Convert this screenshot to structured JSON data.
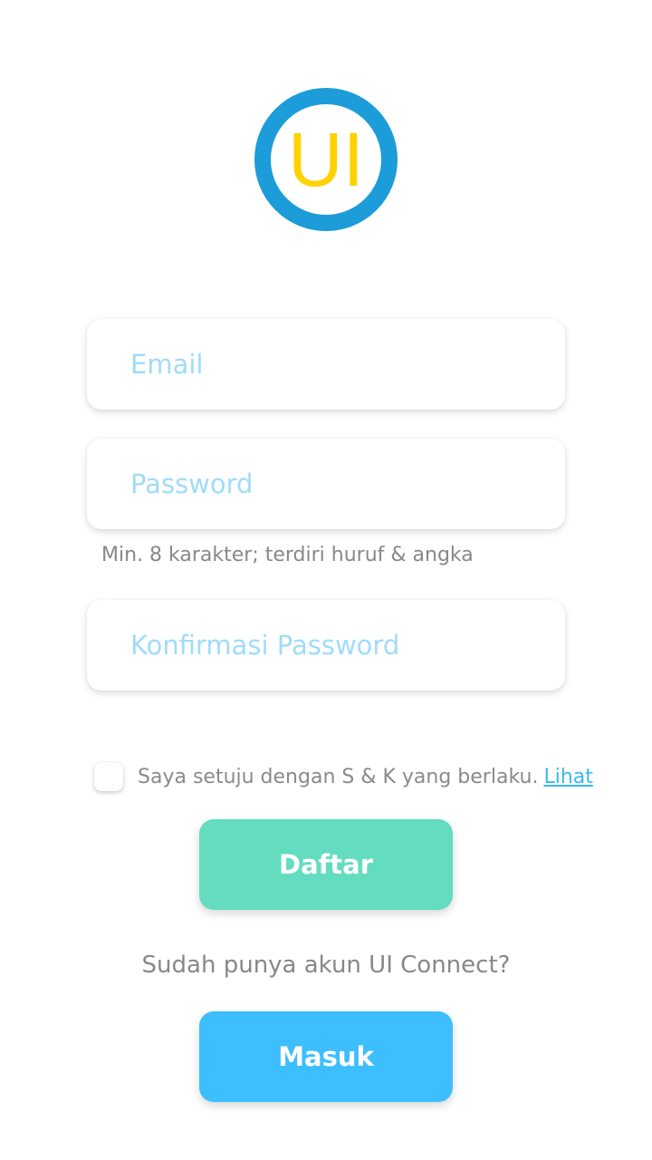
{
  "logo": {
    "text": "UI",
    "ring_color": "#1c9cd9",
    "text_color": "#ffd200"
  },
  "form": {
    "email_placeholder": "Email",
    "password_placeholder": "Password",
    "password_hint": "Min. 8 karakter; terdiri huruf & angka",
    "confirm_placeholder": "Konfirmasi Password",
    "terms_text": "Saya setuju dengan S & K yang berlaku.",
    "terms_link": "Lihat",
    "terms_checked": false
  },
  "buttons": {
    "register_label": "Daftar",
    "register_color": "#63dcc0",
    "login_label": "Masuk",
    "login_color": "#3dbeff"
  },
  "login_prompt": "Sudah punya akun UI Connect?",
  "colors": {
    "placeholder": "#9fdcf9",
    "link": "#39b9f1",
    "muted_text": "#888888"
  }
}
